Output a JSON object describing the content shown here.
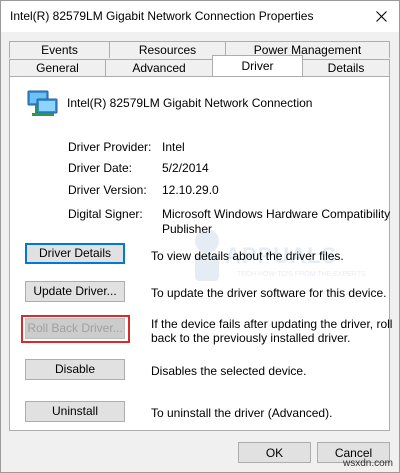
{
  "window": {
    "title": "Intel(R) 82579LM Gigabit Network Connection Properties"
  },
  "tabs": {
    "row_top": [
      {
        "label": "Events"
      },
      {
        "label": "Resources"
      },
      {
        "label": "Power Management"
      }
    ],
    "row_bottom": [
      {
        "label": "General"
      },
      {
        "label": "Advanced"
      },
      {
        "label": "Driver",
        "active": true
      },
      {
        "label": "Details"
      }
    ]
  },
  "device": {
    "name": "Intel(R) 82579LM Gigabit Network Connection",
    "icon": "network-adapter-icon"
  },
  "properties": [
    {
      "label": "Driver Provider:",
      "value": "Intel"
    },
    {
      "label": "Driver Date:",
      "value": "5/2/2014"
    },
    {
      "label": "Driver Version:",
      "value": "12.10.29.0"
    },
    {
      "label": "Digital Signer:",
      "value_line1": "Microsoft Windows Hardware Compatibility",
      "value_line2": "Publisher"
    }
  ],
  "actions": [
    {
      "label": "Driver Details",
      "description": "To view details about the driver files.",
      "state": "focused"
    },
    {
      "label": "Update Driver...",
      "description": "To update the driver software for this device.",
      "state": "normal"
    },
    {
      "label": "Roll Back Driver...",
      "description_line1": "If the device fails after updating the driver, roll",
      "description_line2": "back to the previously installed driver.",
      "state": "disabled"
    },
    {
      "label": "Disable",
      "description": "Disables the selected device.",
      "state": "normal"
    },
    {
      "label": "Uninstall",
      "description": "To uninstall the driver (Advanced).",
      "state": "normal"
    }
  ],
  "watermark": {
    "text": "APPUALS",
    "subtext": "TECH HOW-TO'S FROM THE EXPERTS"
  },
  "footer": {
    "ok_label": "OK",
    "cancel_label": "Cancel"
  },
  "site_mark": "wsxdn.com",
  "colors": {
    "highlight": "#d92b2b",
    "focus": "#0078d7"
  }
}
